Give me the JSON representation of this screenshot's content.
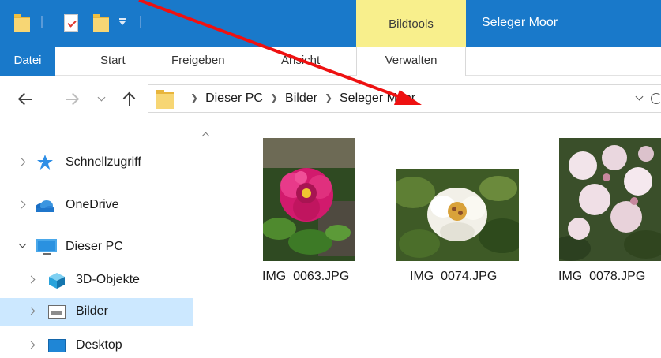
{
  "title_bar": {
    "context_tab": "Bildtools",
    "window_title": "Seleger Moor",
    "background": "#1979ca",
    "context_color": "#f8ef8c"
  },
  "ribbon": {
    "file_tab": "Datei",
    "tabs": [
      "Start",
      "Freigeben",
      "Ansicht"
    ],
    "context_subtab": "Verwalten"
  },
  "address_bar": {
    "crumbs": [
      "Dieser PC",
      "Bilder",
      "Seleger Moor"
    ]
  },
  "sidebar": {
    "items": [
      {
        "label": "Schnellzugriff",
        "icon": "star-icon"
      },
      {
        "label": "OneDrive",
        "icon": "onedrive-cloud-icon"
      },
      {
        "label": "Dieser PC",
        "icon": "computer-icon"
      },
      {
        "label": "3D-Objekte",
        "icon": "3d-objects-icon"
      },
      {
        "label": "Bilder",
        "icon": "pictures-folder-icon",
        "selected": true
      },
      {
        "label": "Desktop",
        "icon": "desktop-folder-icon"
      }
    ],
    "selected_color": "#cce8ff"
  },
  "files": [
    {
      "name": "IMG_0063.JPG"
    },
    {
      "name": "IMG_0074.JPG"
    },
    {
      "name": "IMG_0078.JPG"
    }
  ],
  "annotation": {
    "color": "#ee1111"
  }
}
